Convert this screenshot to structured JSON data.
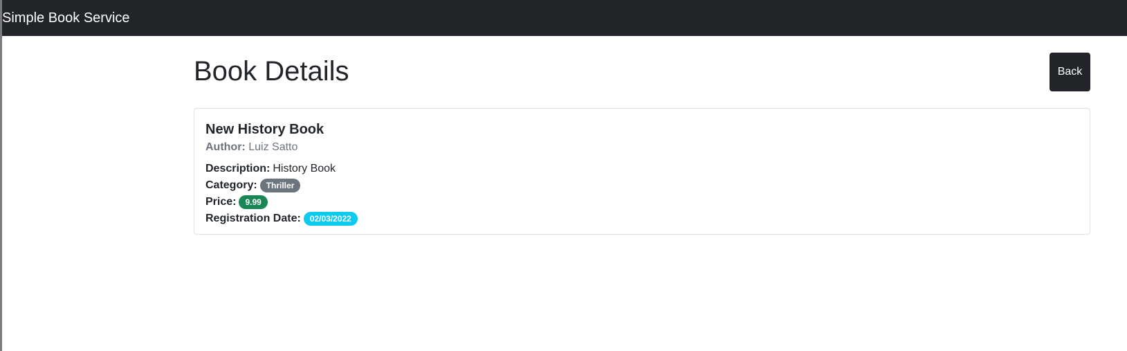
{
  "navbar": {
    "brand": "Simple Book Service"
  },
  "page": {
    "title": "Book Details",
    "back_label": "Back"
  },
  "book": {
    "title": "New History Book",
    "author_label": "Author:",
    "author": "Luiz Satto",
    "description_label": "Description:",
    "description": "History Book",
    "category_label": "Category:",
    "category": "Thriller",
    "price_label": "Price:",
    "price": "9.99",
    "registration_label": "Registration Date:",
    "registration_date": "02/03/2022"
  },
  "colors": {
    "navbar": "#212529",
    "category_badge": "#6c757d",
    "price_badge": "#198754",
    "date_badge": "#0dcaf0"
  }
}
